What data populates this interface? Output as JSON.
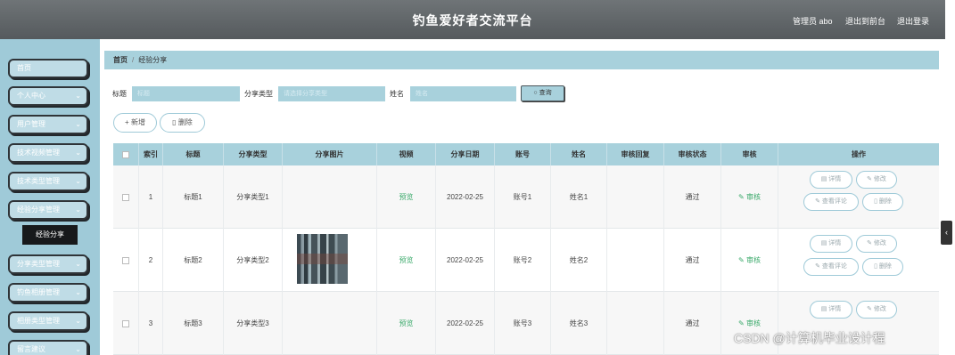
{
  "header": {
    "title": "钓鱼爱好者交流平台",
    "user": "管理员 abo",
    "back_front": "退出到前台",
    "logout": "退出登录"
  },
  "sidebar": {
    "items": [
      {
        "label": "首页",
        "chevron": false
      },
      {
        "label": "个人中心",
        "chevron": true
      },
      {
        "label": "用户管理",
        "chevron": true
      },
      {
        "label": "技术视频管理",
        "chevron": true
      },
      {
        "label": "技术类型管理",
        "chevron": true
      },
      {
        "label": "经验分享管理",
        "chevron": true
      },
      {
        "label": "分享类型管理",
        "chevron": true
      },
      {
        "label": "钓鱼相册管理",
        "chevron": true
      },
      {
        "label": "相册类型管理",
        "chevron": true
      },
      {
        "label": "留言建议",
        "chevron": true
      }
    ],
    "active_sub": "经验分享",
    "chevron_glyph": "⌄"
  },
  "breadcrumb": {
    "home": "首页",
    "sep": "/",
    "current": "经验分享"
  },
  "search": {
    "title_label": "标题",
    "title_placeholder": "标题",
    "type_label": "分享类型",
    "type_placeholder": "请选择分享类型",
    "name_label": "姓名",
    "name_placeholder": "姓名",
    "query_label": "查询"
  },
  "actions": {
    "add": "新增",
    "delete": "删除"
  },
  "table": {
    "headers": [
      "索引",
      "标题",
      "分享类型",
      "分享图片",
      "视频",
      "分享日期",
      "账号",
      "姓名",
      "审核回复",
      "审核状态",
      "审核",
      "操作"
    ],
    "rows": [
      {
        "index": "1",
        "title": "标题1",
        "type": "分享类型1",
        "video": "预览",
        "date": "2022-02-25",
        "account": "账号1",
        "name": "姓名1",
        "reply": "",
        "status": "通过",
        "audit": "审核",
        "has_image": false
      },
      {
        "index": "2",
        "title": "标题2",
        "type": "分享类型2",
        "video": "预览",
        "date": "2022-02-25",
        "account": "账号2",
        "name": "姓名2",
        "reply": "",
        "status": "通过",
        "audit": "审核",
        "has_image": true
      },
      {
        "index": "3",
        "title": "标题3",
        "type": "分享类型3",
        "video": "预览",
        "date": "2022-02-25",
        "account": "账号3",
        "name": "姓名3",
        "reply": "",
        "status": "通过",
        "audit": "审核",
        "has_image": false
      }
    ],
    "ops": {
      "detail": "详情",
      "edit": "修改",
      "comments": "查看评论",
      "delete": "删除"
    }
  },
  "watermark": "CSDN @计算机毕业设计程"
}
